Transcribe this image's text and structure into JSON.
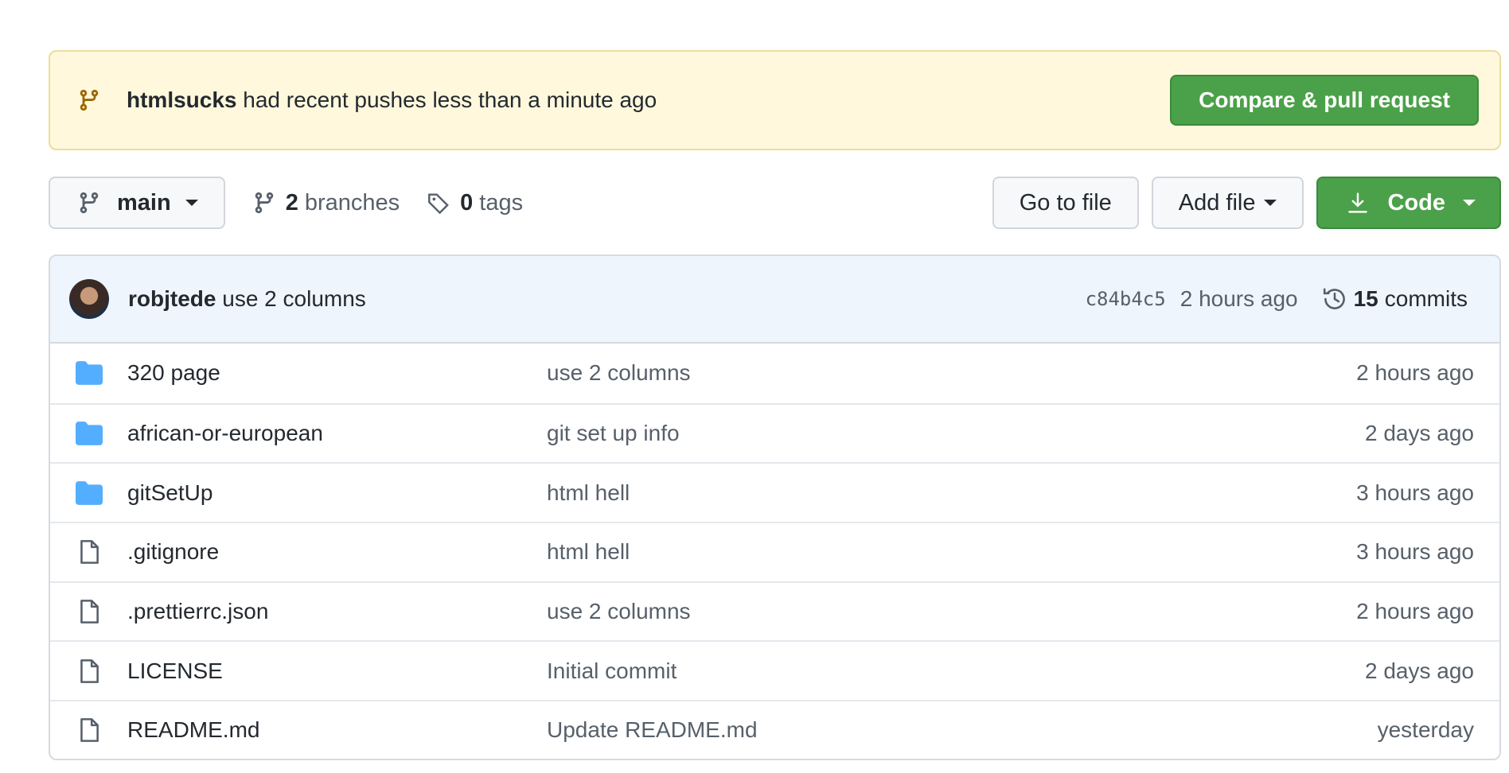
{
  "banner": {
    "user": "htmlsucks",
    "message": "had recent pushes less than a minute ago",
    "button_label": "Compare & pull request"
  },
  "toolbar": {
    "branch": "main",
    "branches_count": "2",
    "branches_label": "branches",
    "tags_count": "0",
    "tags_label": "tags",
    "goto_label": "Go to file",
    "addfile_label": "Add file",
    "code_label": "Code"
  },
  "commit": {
    "author": "robjtede",
    "message": "use 2 columns",
    "sha": "c84b4c5",
    "time": "2 hours ago",
    "commits_count": "15",
    "commits_label": "commits"
  },
  "files": [
    {
      "type": "folder",
      "name": "320 page",
      "commit": "use 2 columns",
      "age": "2 hours ago"
    },
    {
      "type": "folder",
      "name": "african-or-european",
      "commit": "git set up info",
      "age": "2 days ago"
    },
    {
      "type": "folder",
      "name": "gitSetUp",
      "commit": "html hell",
      "age": "3 hours ago"
    },
    {
      "type": "file",
      "name": ".gitignore",
      "commit": "html hell",
      "age": "3 hours ago"
    },
    {
      "type": "file",
      "name": ".prettierrc.json",
      "commit": "use 2 columns",
      "age": "2 hours ago"
    },
    {
      "type": "file",
      "name": "LICENSE",
      "commit": "Initial commit",
      "age": "2 days ago"
    },
    {
      "type": "file",
      "name": "README.md",
      "commit": "Update README.md",
      "age": "yesterday"
    }
  ],
  "colors": {
    "accent_green": "#4ba149",
    "banner_bg": "#fff8dc",
    "folder_blue": "#54aeff"
  }
}
